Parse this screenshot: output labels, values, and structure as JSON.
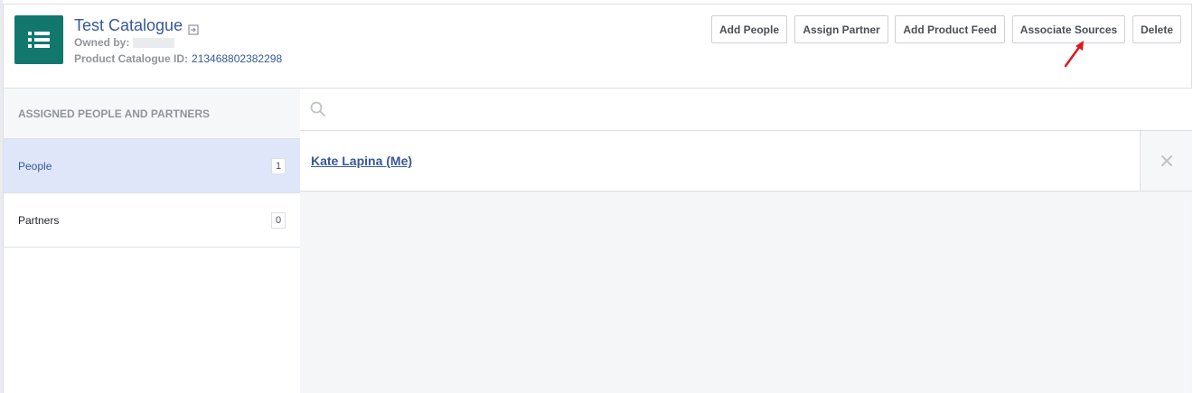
{
  "header": {
    "title": "Test Catalogue",
    "owned_by_label": "Owned by:",
    "catalogue_id_label": "Product Catalogue ID:",
    "catalogue_id": "213468802382298",
    "icon": "list-icon",
    "accent_color": "#12786d"
  },
  "toolbar": {
    "add_people": "Add People",
    "assign_partner": "Assign Partner",
    "add_product_feed": "Add Product Feed",
    "associate_sources": "Associate Sources",
    "delete": "Delete"
  },
  "sidebar": {
    "heading": "ASSIGNED PEOPLE AND PARTNERS",
    "items": [
      {
        "label": "People",
        "count": "1",
        "active": true
      },
      {
        "label": "Partners",
        "count": "0",
        "active": false
      }
    ]
  },
  "main": {
    "search": {
      "placeholder": "",
      "value": ""
    },
    "people": [
      {
        "name": "Kate Lapina (Me)"
      }
    ]
  },
  "annotation": {
    "color": "#e0161c"
  }
}
